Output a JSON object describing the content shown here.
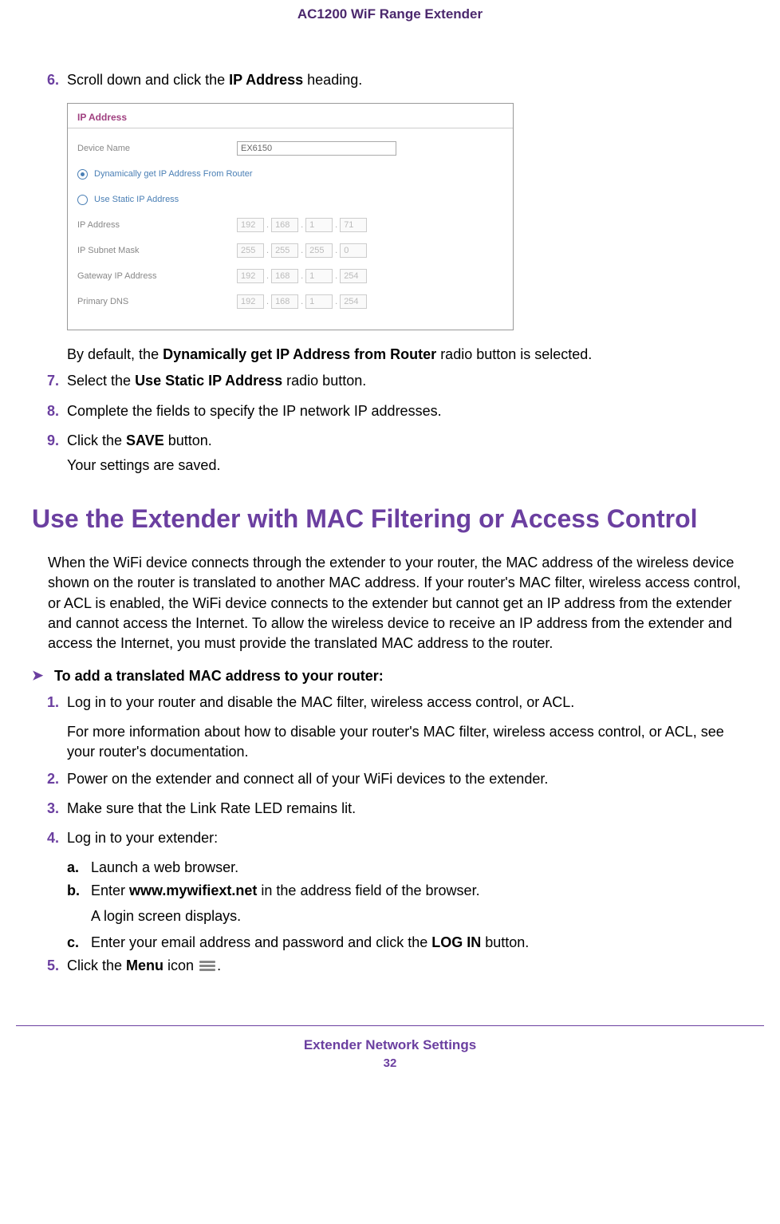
{
  "header": {
    "title": "AC1200 WiF Range Extender"
  },
  "steps_top": {
    "s6_num": "6.",
    "s6_text_pre": "Scroll down and click the ",
    "s6_text_bold": "IP Address",
    "s6_text_post": " heading.",
    "s6_explain_pre": "By default, the ",
    "s6_explain_bold": "Dynamically get IP Address from Router",
    "s6_explain_post": " radio button is selected.",
    "s7_num": "7.",
    "s7_pre": "Select the ",
    "s7_bold": "Use Static IP Address",
    "s7_post": " radio button.",
    "s8_num": "8.",
    "s8_text": "Complete the fields to specify the IP network IP addresses.",
    "s9_num": "9.",
    "s9_pre": "Click the ",
    "s9_bold": "SAVE",
    "s9_post": " button.",
    "s9_after": "Your settings are saved."
  },
  "panel": {
    "title": "IP Address",
    "device_name_label": "Device Name",
    "device_name_value": "EX6150",
    "radio_dynamic": "Dynamically get IP Address From Router",
    "radio_static": "Use Static IP Address",
    "rows": [
      {
        "label": "IP Address",
        "o1": "192",
        "o2": "168",
        "o3": "1",
        "o4": "71"
      },
      {
        "label": "IP Subnet Mask",
        "o1": "255",
        "o2": "255",
        "o3": "255",
        "o4": "0"
      },
      {
        "label": "Gateway IP Address",
        "o1": "192",
        "o2": "168",
        "o3": "1",
        "o4": "254"
      },
      {
        "label": "Primary DNS",
        "o1": "192",
        "o2": "168",
        "o3": "1",
        "o4": "254"
      }
    ]
  },
  "section": {
    "heading": "Use the Extender with MAC Filtering or Access Control",
    "para": "When the WiFi device connects through the extender to your router, the MAC address of the wireless device shown on the router is translated to another MAC address. If your router's MAC filter, wireless access control, or ACL is enabled, the WiFi device connects to the extender but cannot get an IP address from the extender and cannot access the Internet. To allow the wireless device to receive an IP address from the extender and access the Internet, you must provide the translated MAC address to the router."
  },
  "proc": {
    "arrow": "➤",
    "title": "To add a translated MAC address to your router:",
    "s1_num": "1.",
    "s1_text": "Log in to your router and disable the MAC filter, wireless access control, or ACL.",
    "s1_after": "For more information about how to disable your router's MAC filter, wireless access control, or ACL, see your router's documentation.",
    "s2_num": "2.",
    "s2_text": "Power on the extender and connect all of your WiFi devices to the extender.",
    "s3_num": "3.",
    "s3_text": "Make sure that the Link Rate LED remains lit.",
    "s4_num": "4.",
    "s4_text": "Log in to your extender:",
    "s4a_l": "a.",
    "s4a_t": "Launch a web browser.",
    "s4b_l": "b.",
    "s4b_pre": "Enter ",
    "s4b_bold": "www.mywifiext.net",
    "s4b_post": " in the address field of the browser.",
    "s4b_after": "A login screen displays.",
    "s4c_l": "c.",
    "s4c_pre": "Enter your email address and password and click the ",
    "s4c_bold": "LOG IN",
    "s4c_post": " button.",
    "s5_num": "5.",
    "s5_pre": "Click the ",
    "s5_bold": "Menu",
    "s5_mid": " icon ",
    "s5_post": "."
  },
  "footer": {
    "title": "Extender Network Settings",
    "page": "32"
  }
}
